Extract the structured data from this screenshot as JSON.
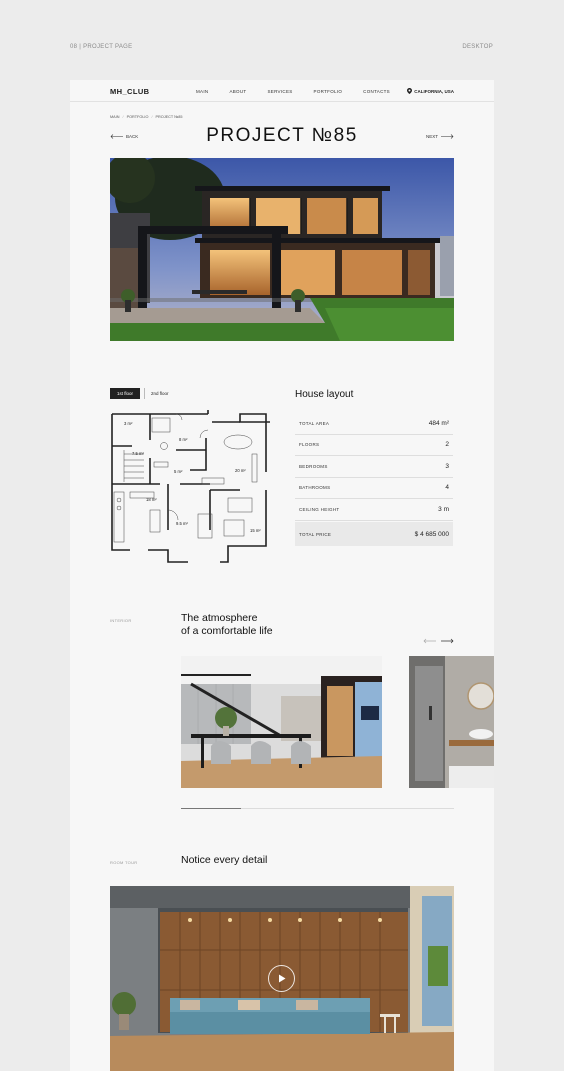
{
  "top": {
    "left_label": "08 | PROJECT PAGE",
    "right_label": "DESKTOP"
  },
  "header": {
    "logo": "MH_CLUB",
    "nav": [
      "MAIN",
      "ABOUT",
      "SERVICES",
      "PORTFOLIO",
      "CONTACTS"
    ],
    "location": "CALIFORNIA, USA"
  },
  "breadcrumb": [
    "MAIN",
    "PORTFOLIO",
    "PROJECT №85"
  ],
  "title": "PROJECT №85",
  "pager": {
    "back": "BACK",
    "next": "NEXT"
  },
  "floors": {
    "tabs": [
      "1st floor",
      "2nd floor"
    ],
    "active": "1st floor"
  },
  "plan_labels": [
    "3 m²",
    "8 m²",
    "7.5 m²",
    "5 m²",
    "20 m²",
    "18 m²",
    "9.5 m²",
    "15 m²"
  ],
  "layout": {
    "title": "House layout",
    "specs": [
      {
        "key": "TOTAL AREA",
        "value": "484 m²"
      },
      {
        "key": "FLOORS",
        "value": "2"
      },
      {
        "key": "BEDROOMS",
        "value": "3"
      },
      {
        "key": "BATHROOMS",
        "value": "4"
      },
      {
        "key": "CEILING HEIGHT",
        "value": "3 m"
      }
    ],
    "total": {
      "key": "TOTAL PRICE",
      "value": "$ 4 685 000"
    }
  },
  "interior": {
    "label": "INTERIOR",
    "title_line1": "The atmosphere",
    "title_line2": "of a comfortable life",
    "slider_progress": 0.22
  },
  "room_tour": {
    "label": "ROOM TOUR",
    "title": "Notice every detail"
  },
  "colors": {
    "accent": "#222222",
    "page_bg": "#f7f7f7",
    "outer_bg": "#ececec"
  }
}
